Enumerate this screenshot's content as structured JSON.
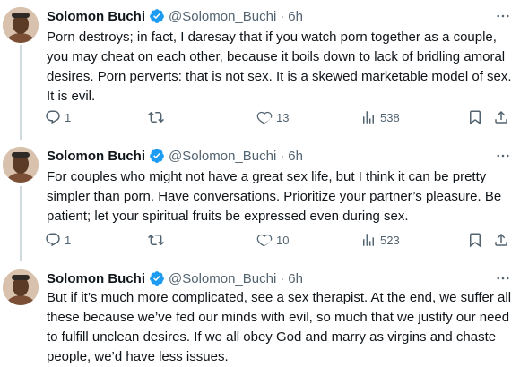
{
  "tweets": [
    {
      "name": "Solomon Buchi",
      "handle": "@Solomon_Buchi",
      "time": "6h",
      "text": "Porn destroys; in fact, I daresay that if you watch porn together as a couple, you may cheat on each other, because it boils down to lack of bridling amoral desires. Porn perverts: that is not sex. It is a skewed marketable model of sex. It is evil.",
      "replies": "1",
      "reposts": "",
      "likes": "13",
      "views": "538"
    },
    {
      "name": "Solomon Buchi",
      "handle": "@Solomon_Buchi",
      "time": "6h",
      "text": "For couples who might not have a great sex life, but I think it can be pretty simpler than porn. Have conversations. Prioritize your partner’s pleasure. Be patient; let your spiritual fruits be expressed even during sex.",
      "replies": "1",
      "reposts": "",
      "likes": "10",
      "views": "523"
    },
    {
      "name": "Solomon Buchi",
      "handle": "@Solomon_Buchi",
      "time": "6h",
      "text": "But if it’s much more complicated, see a sex therapist. At the end, we suffer all these because we’ve fed our minds with evil, so much that we justify our need to fulfill unclean desires. If we all obey God and marry as virgins and chaste people, we’d have less issues."
    }
  ],
  "separator": "·",
  "more_label": "···",
  "colors": {
    "verified": "#1d9bf0",
    "secondary": "#536471",
    "thread_line": "#cfd9de"
  },
  "icons": [
    "verified-badge-icon",
    "more-icon",
    "reply-icon",
    "repost-icon",
    "like-icon",
    "views-icon",
    "bookmark-icon"
  ]
}
